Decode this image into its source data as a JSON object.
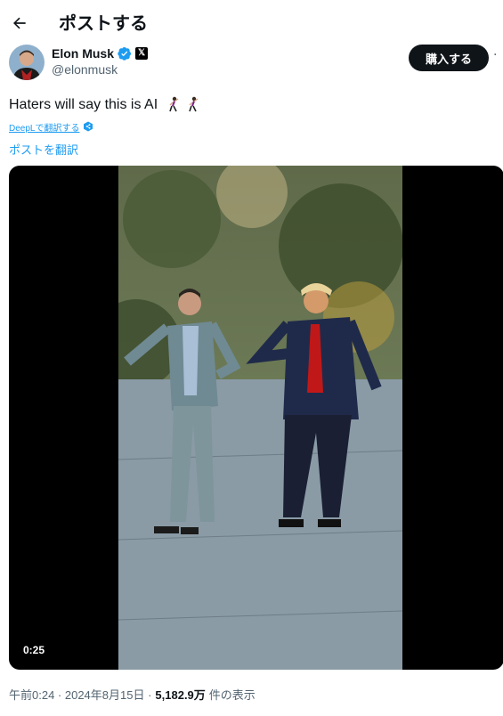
{
  "header": {
    "back_icon": "arrow-left-icon",
    "title": "ポストする"
  },
  "author": {
    "name": "Elon Musk",
    "handle": "@elonmusk",
    "verified_color": "#1d9bf0",
    "affiliate_badge": "𝕏"
  },
  "actions": {
    "buy_label": "購入する",
    "more_label": "·"
  },
  "post": {
    "text": "Haters will say this is AI",
    "emoji": [
      "man-dancing-emoji",
      "man-dancing-emoji"
    ],
    "deepl_link": "DeepLで翻訳する",
    "translate_link": "ポストを翻訳"
  },
  "video": {
    "timestamp": "0:25"
  },
  "meta": {
    "time_date": "午前0:24 · 2024年8月15日 ·",
    "views": "5,182.9万",
    "views_label": "件の表示"
  },
  "colors": {
    "accent": "#1d9bf0",
    "text": "#0f1419",
    "muted": "#536471"
  }
}
